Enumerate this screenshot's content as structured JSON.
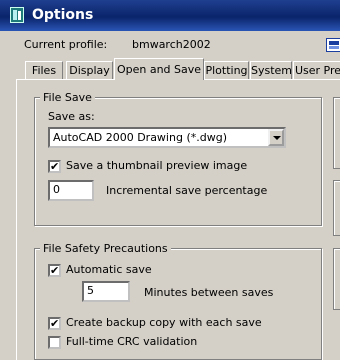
{
  "window": {
    "title": "Options"
  },
  "profile": {
    "label": "Current profile:",
    "name": "bmwarch2002"
  },
  "tabs": [
    {
      "label": "Files"
    },
    {
      "label": "Display"
    },
    {
      "label": "Open and Save"
    },
    {
      "label": "Plotting"
    },
    {
      "label": "System"
    },
    {
      "label": "User Pre"
    }
  ],
  "file_save": {
    "title": "File Save",
    "save_as_label": "Save as:",
    "save_as_value": "AutoCAD 2000 Drawing (*.dwg)",
    "thumbnail_label": "Save a thumbnail preview image",
    "thumbnail_checked": "✔",
    "incremental_value": "0",
    "incremental_label": "Incremental save percentage"
  },
  "file_safety": {
    "title": "File Safety Precautions",
    "autosave_label": "Automatic save",
    "autosave_checked": "✔",
    "minutes_value": "5",
    "minutes_label": "Minutes between saves",
    "backup_label": "Create backup copy with each save",
    "backup_checked": "✔",
    "crc_label": "Full-time CRC validation"
  }
}
